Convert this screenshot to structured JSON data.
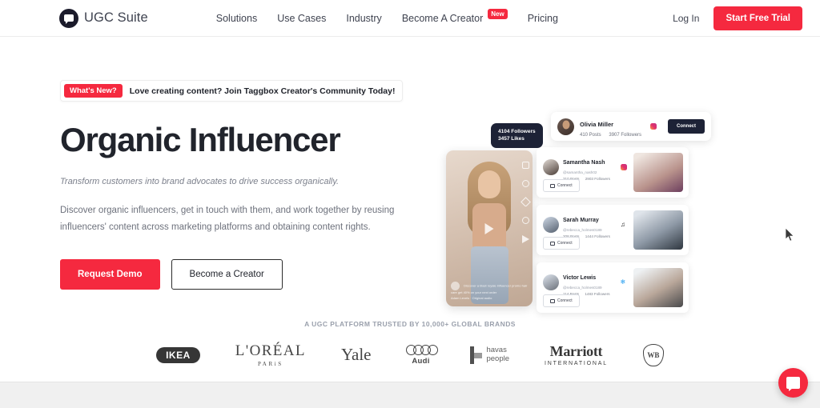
{
  "navbar": {
    "brand_name": "UGC Suite",
    "links": [
      {
        "label": "Solutions"
      },
      {
        "label": "Use Cases"
      },
      {
        "label": "Industry"
      },
      {
        "label": "Become A Creator",
        "badge": "New"
      },
      {
        "label": "Pricing"
      }
    ],
    "login_label": "Log In",
    "cta_label": "Start Free Trial",
    "accent_color": "#f5293f"
  },
  "hero": {
    "announcement": {
      "pill": "What's New?",
      "text": "Love creating content? Join Taggbox Creator's Community Today!"
    },
    "title": "Organic Influencer",
    "subtitle": "Transform customers into brand advocates to drive success organically.",
    "description": "Discover organic influencers, get in touch with them, and work together by reusing influencers' content across marketing platforms and obtaining content rights.",
    "primary_button": "Request Demo",
    "secondary_button": "Become a Creator"
  },
  "visual": {
    "stat_badge": {
      "followers": "4104 Followers",
      "likes": "3457 Likes"
    },
    "reel": {
      "caption": "Discover a blast royale influencer promo hair care get 40% on your next order",
      "audio": "Adam Levels · Original audio"
    },
    "featured_card": {
      "name": "Olivia Miller",
      "posts": "410 Posts",
      "followers": "3907 Followers",
      "platform": "instagram-icon",
      "connect_label": "Connect"
    },
    "influencers": [
      {
        "name": "Samantha Nash",
        "handle": "@samantha_nash02",
        "posts": "310 Posts",
        "followers": "2903 Followers",
        "platform": "instagram-icon",
        "connect_label": "Connect"
      },
      {
        "name": "Sarah Murray",
        "handle": "@rebecca_holmes0189",
        "posts": "208 Posts",
        "followers": "1444 Followers",
        "platform": "tiktok-icon",
        "connect_label": "Connect"
      },
      {
        "name": "Victor Lewis",
        "handle": "@rebecca_holmes0189",
        "posts": "114 Posts",
        "followers": "1483 Followers",
        "platform": "twitter-icon",
        "connect_label": "Connect"
      }
    ]
  },
  "brands": {
    "label": "A UGC PLATFORM TRUSTED BY 10,000+ GLOBAL BRANDS",
    "logos": [
      {
        "name": "IKEA",
        "main": "IKEA",
        "sub": ""
      },
      {
        "name": "L'Oreal Paris",
        "main": "L'ORÉAL",
        "sub": "PARiS"
      },
      {
        "name": "Yale",
        "main": "Yale",
        "sub": ""
      },
      {
        "name": "Audi",
        "main": "",
        "sub": "Audi"
      },
      {
        "name": "Havas People",
        "main": "havas",
        "sub": "people"
      },
      {
        "name": "Marriott International",
        "main": "Marriott",
        "sub": "INTERNATIONAL"
      },
      {
        "name": "Warner Bros",
        "main": "WB",
        "sub": ""
      }
    ]
  },
  "chat_widget": {
    "icon": "chat-bubble-icon"
  }
}
